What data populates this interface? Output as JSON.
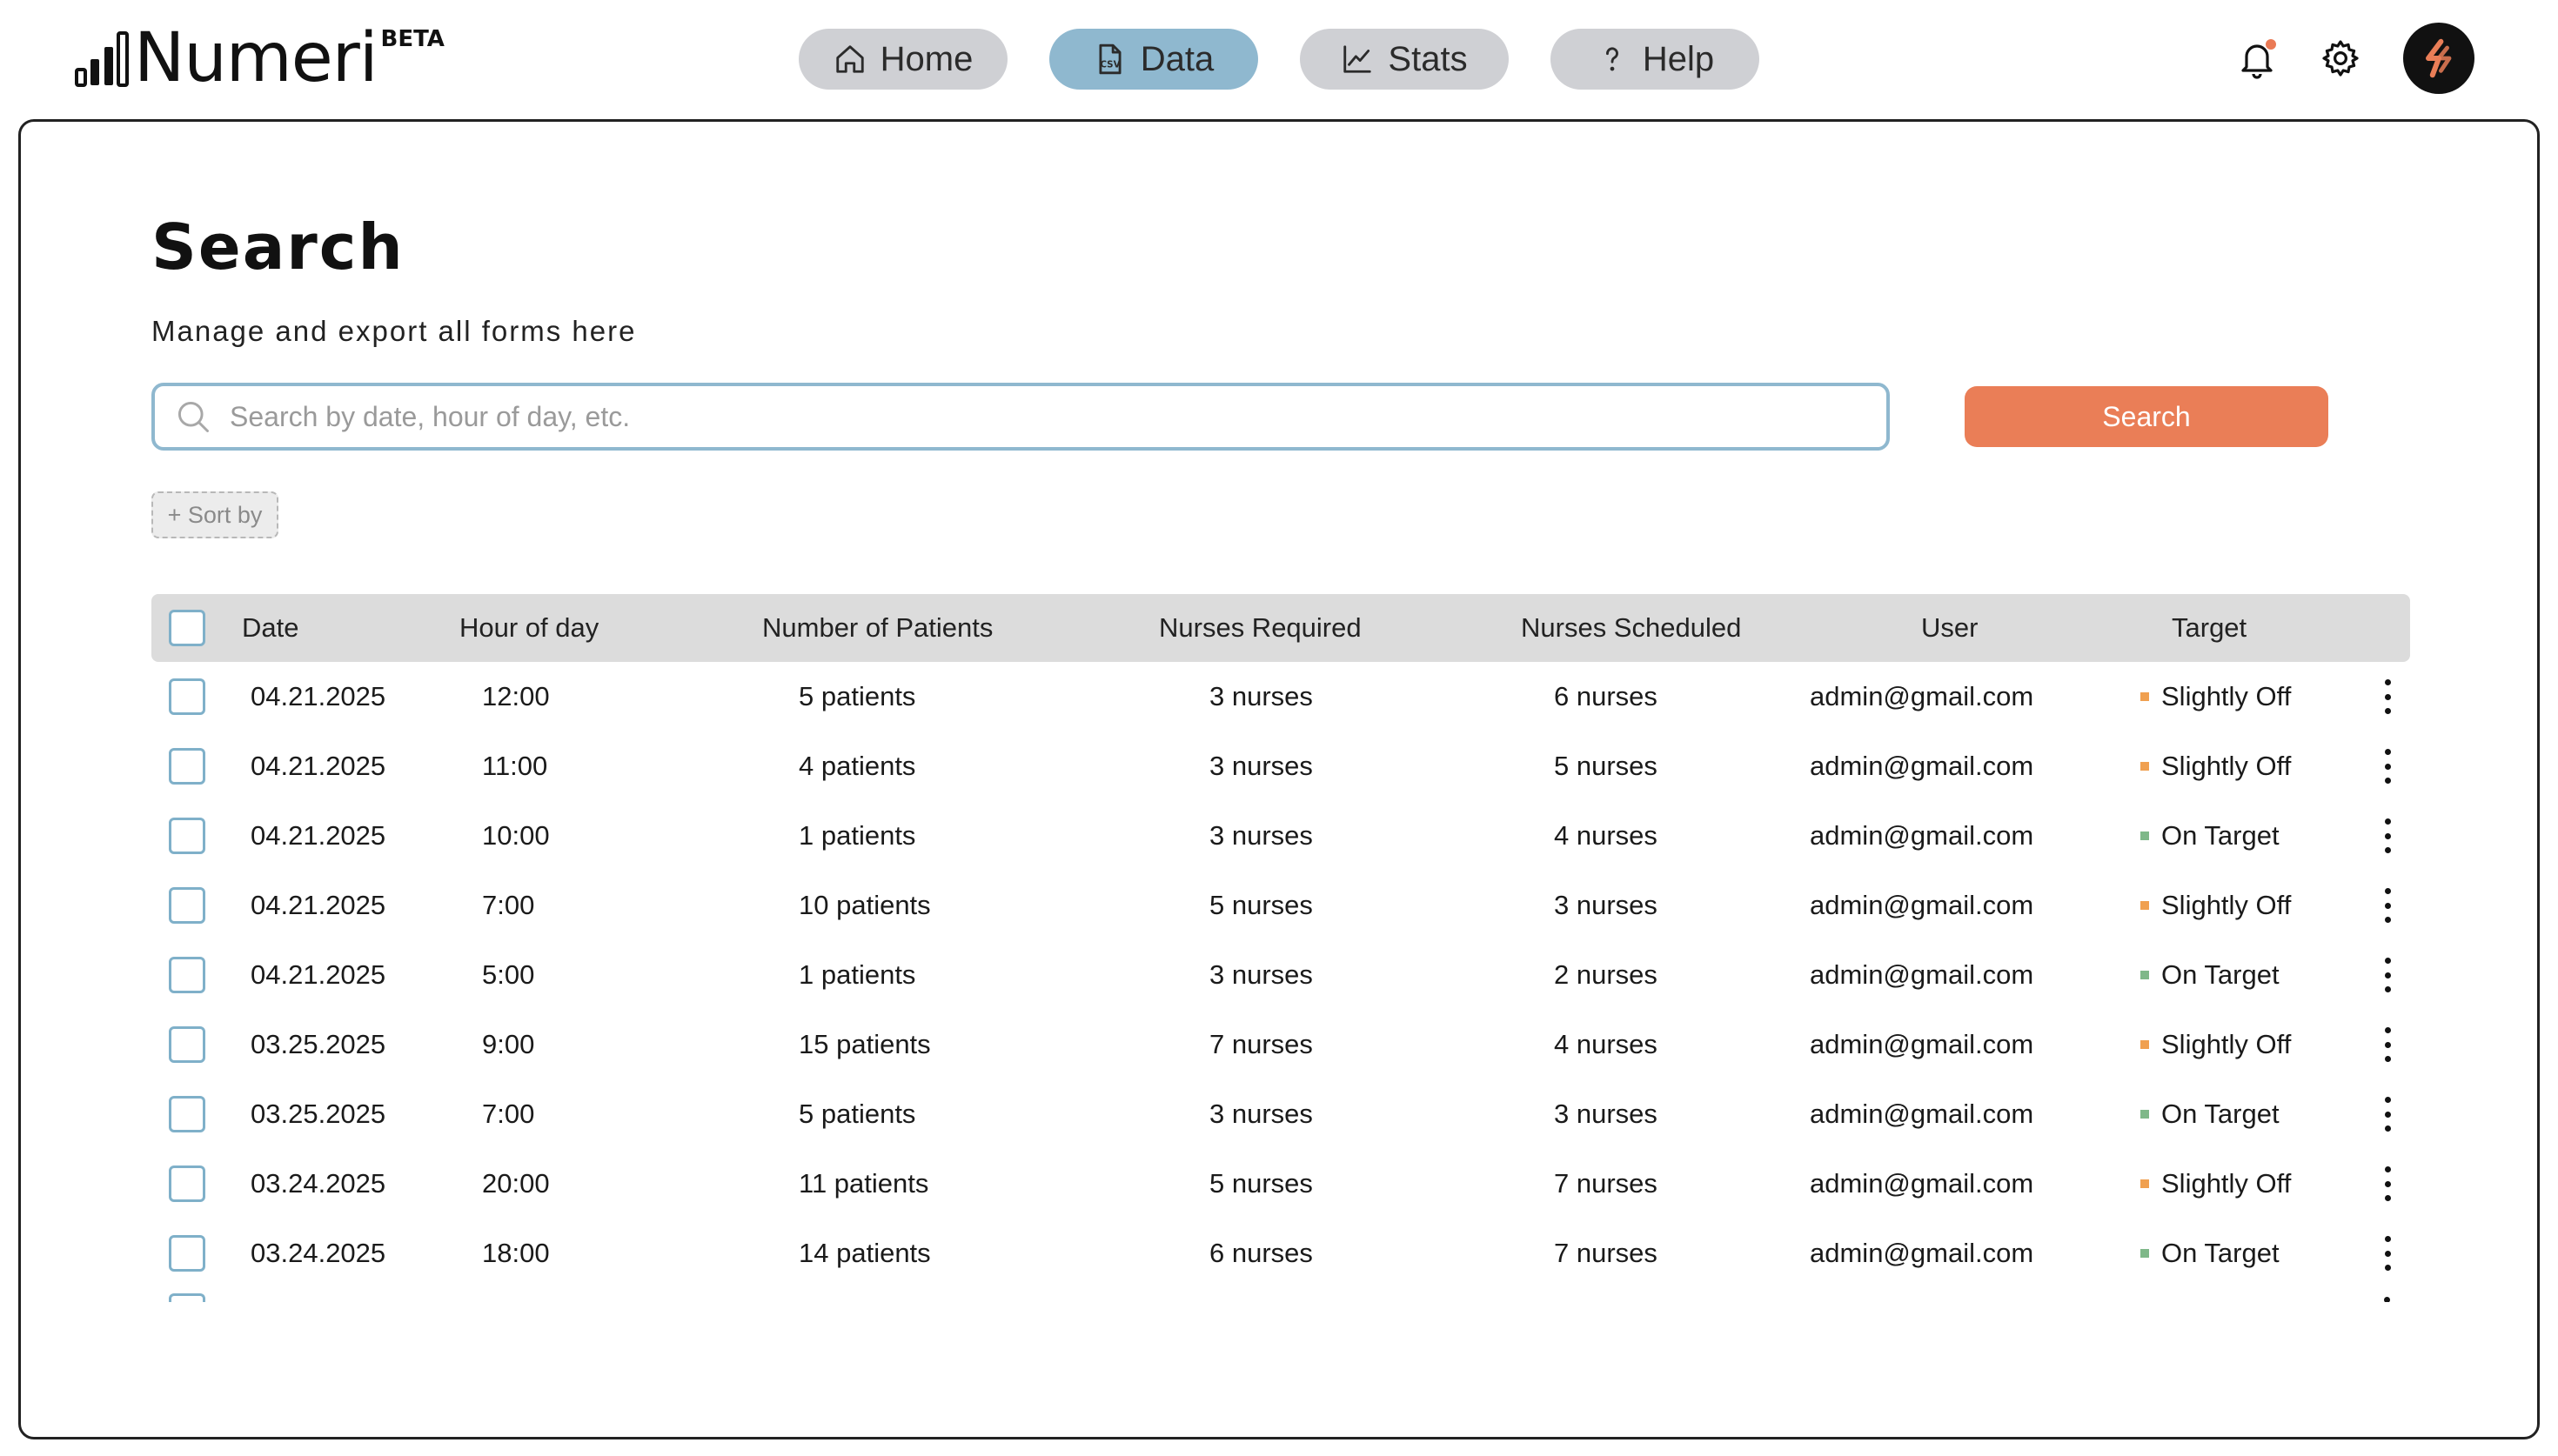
{
  "brand": {
    "name": "Numeri",
    "badge": "BETA",
    "logo_icon": "bar-chart-logo-icon"
  },
  "nav": [
    {
      "label": "Home",
      "icon": "home-icon",
      "active": false
    },
    {
      "label": "Data",
      "icon": "csv-file-icon",
      "active": true
    },
    {
      "label": "Stats",
      "icon": "line-chart-icon",
      "active": false
    },
    {
      "label": "Help",
      "icon": "question-mark-icon",
      "active": false
    }
  ],
  "top_icons": {
    "notifications": "bell-icon",
    "settings": "gear-icon",
    "profile": "avatar-logo-icon"
  },
  "page": {
    "title": "Search",
    "subtitle": "Manage and export all forms here"
  },
  "search": {
    "placeholder": "Search by date, hour of day, etc.",
    "value": "",
    "button_label": "Search"
  },
  "sort": {
    "label": "+ Sort by"
  },
  "table": {
    "columns": [
      "Date",
      "Hour of day",
      "Number of Patients",
      "Nurses Required",
      "Nurses Scheduled",
      "User",
      "Target"
    ],
    "rows": [
      {
        "date": "04.21.2025",
        "hour": "12:00",
        "patients": "5 patients",
        "required": "3 nurses",
        "scheduled": "6 nurses",
        "user": "admin@gmail.com",
        "target": "Slightly Off"
      },
      {
        "date": "04.21.2025",
        "hour": "11:00",
        "patients": "4 patients",
        "required": "3 nurses",
        "scheduled": "5 nurses",
        "user": "admin@gmail.com",
        "target": "Slightly Off"
      },
      {
        "date": "04.21.2025",
        "hour": "10:00",
        "patients": "1 patients",
        "required": "3 nurses",
        "scheduled": "4 nurses",
        "user": "admin@gmail.com",
        "target": "On Target"
      },
      {
        "date": "04.21.2025",
        "hour": "7:00",
        "patients": "10 patients",
        "required": "5 nurses",
        "scheduled": "3 nurses",
        "user": "admin@gmail.com",
        "target": "Slightly Off"
      },
      {
        "date": "04.21.2025",
        "hour": "5:00",
        "patients": "1 patients",
        "required": "3 nurses",
        "scheduled": "2 nurses",
        "user": "admin@gmail.com",
        "target": "On Target"
      },
      {
        "date": "03.25.2025",
        "hour": "9:00",
        "patients": "15 patients",
        "required": "7 nurses",
        "scheduled": "4 nurses",
        "user": "admin@gmail.com",
        "target": "Slightly Off"
      },
      {
        "date": "03.25.2025",
        "hour": "7:00",
        "patients": "5 patients",
        "required": "3 nurses",
        "scheduled": "3 nurses",
        "user": "admin@gmail.com",
        "target": "On Target"
      },
      {
        "date": "03.24.2025",
        "hour": "20:00",
        "patients": "11 patients",
        "required": "5 nurses",
        "scheduled": "7 nurses",
        "user": "admin@gmail.com",
        "target": "Slightly Off"
      },
      {
        "date": "03.24.2025",
        "hour": "18:00",
        "patients": "14 patients",
        "required": "6 nurses",
        "scheduled": "7 nurses",
        "user": "admin@gmail.com",
        "target": "On Target"
      }
    ]
  },
  "colors": {
    "accent_orange": "#ea7e57",
    "active_nav": "#8fb8cf",
    "nav_inactive": "#cfd0d4",
    "status_slightly_off": "#f0a050",
    "status_on_target": "#7fb889",
    "checkbox_border": "#7fb0c9",
    "table_header": "#dcdcdc"
  }
}
